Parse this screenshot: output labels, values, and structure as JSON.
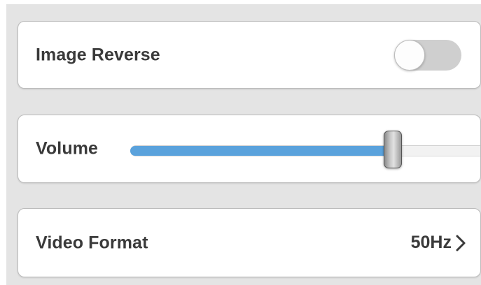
{
  "settings": {
    "image_reverse": {
      "label": "Image Reverse",
      "enabled": false
    },
    "volume": {
      "label": "Volume",
      "level_percent": 75
    },
    "video_format": {
      "label": "Video Format",
      "value": "50Hz",
      "icon": "chevron-right-icon"
    }
  },
  "colors": {
    "background": "#e4e4e4",
    "card": "#ffffff",
    "text": "#3a3a3a",
    "slider_fill": "#5aa2dc",
    "toggle_off": "#cfcfcf"
  }
}
